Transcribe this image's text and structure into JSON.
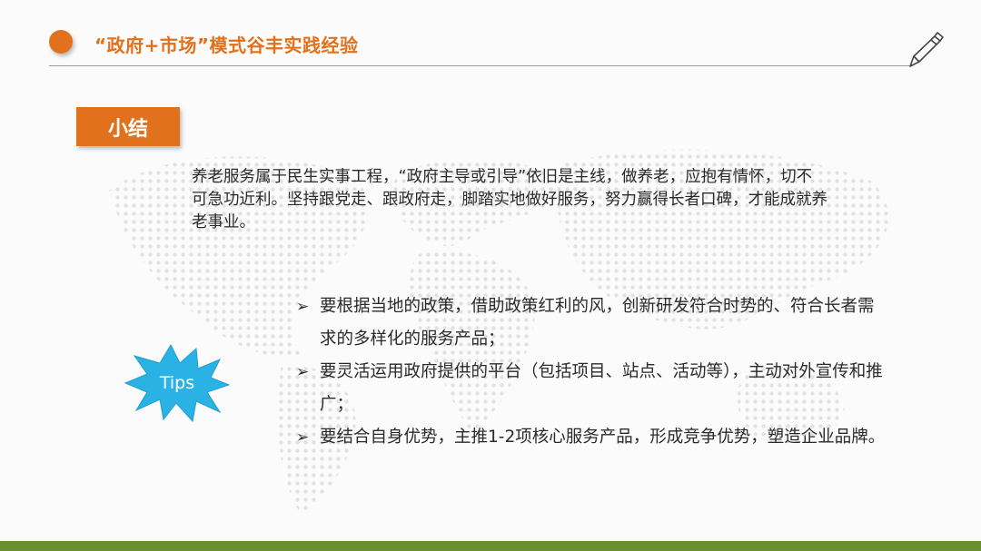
{
  "header": {
    "title": "“政府+市场”模式谷丰实践经验"
  },
  "section": {
    "label": "小结"
  },
  "summary": {
    "text": "养老服务属于民生实事工程，“政府主导或引导”依旧是主线，做养老，应抱有情怀，切不可急功近利。坚持跟党走、跟政府走，脚踏实地做好服务，努力赢得长者口碑，才能成就养老事业。"
  },
  "bullets": {
    "marker": "➢",
    "items": [
      {
        "text": "要根据当地的政策，借助政策红利的风，创新研发符合时势的、符合长者需求的多样化的服务产品；"
      },
      {
        "text": "要灵活运用政府提供的平台（包括项目、站点、活动等），主动对外宣传和推广；"
      },
      {
        "text": "要结合自身优势，主推1-2项核心服务产品，形成竞争优势，塑造企业品牌。"
      }
    ]
  },
  "badge": {
    "label": "Tips"
  },
  "colors": {
    "accent": "#e2711d",
    "badge": "#2bb2e4",
    "footer": "#6b8e2e"
  },
  "icons": {
    "header_dot": "orange-circle-icon",
    "pen": "pen-icon",
    "background": "world-map-dots"
  }
}
